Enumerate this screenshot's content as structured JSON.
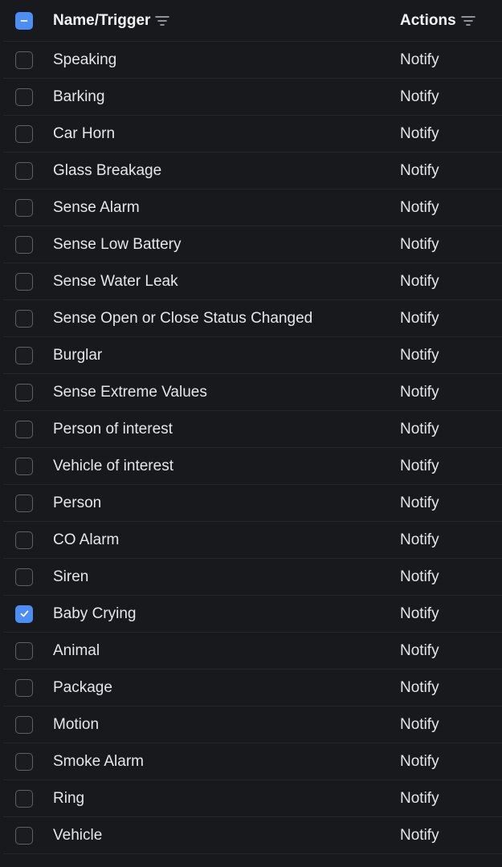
{
  "header": {
    "name_label": "Name/Trigger",
    "actions_label": "Actions",
    "filter_icon": "filter-lines-icon",
    "select_all_state": "indeterminate"
  },
  "colors": {
    "background": "#18191c",
    "accent": "#4d8df6",
    "divider": "#26272b",
    "text": "#e6e7ea"
  },
  "rows": [
    {
      "name": "Speaking",
      "action": "Notify",
      "checked": false
    },
    {
      "name": "Barking",
      "action": "Notify",
      "checked": false
    },
    {
      "name": "Car Horn",
      "action": "Notify",
      "checked": false
    },
    {
      "name": "Glass Breakage",
      "action": "Notify",
      "checked": false
    },
    {
      "name": "Sense Alarm",
      "action": "Notify",
      "checked": false
    },
    {
      "name": "Sense Low Battery",
      "action": "Notify",
      "checked": false
    },
    {
      "name": "Sense Water Leak",
      "action": "Notify",
      "checked": false
    },
    {
      "name": "Sense Open or Close Status Changed",
      "action": "Notify",
      "checked": false
    },
    {
      "name": "Burglar",
      "action": "Notify",
      "checked": false
    },
    {
      "name": "Sense Extreme Values",
      "action": "Notify",
      "checked": false
    },
    {
      "name": "Person of interest",
      "action": "Notify",
      "checked": false
    },
    {
      "name": "Vehicle of interest",
      "action": "Notify",
      "checked": false
    },
    {
      "name": "Person",
      "action": "Notify",
      "checked": false
    },
    {
      "name": "CO Alarm",
      "action": "Notify",
      "checked": false
    },
    {
      "name": "Siren",
      "action": "Notify",
      "checked": false
    },
    {
      "name": "Baby Crying",
      "action": "Notify",
      "checked": true
    },
    {
      "name": "Animal",
      "action": "Notify",
      "checked": false
    },
    {
      "name": "Package",
      "action": "Notify",
      "checked": false
    },
    {
      "name": "Motion",
      "action": "Notify",
      "checked": false
    },
    {
      "name": "Smoke Alarm",
      "action": "Notify",
      "checked": false
    },
    {
      "name": "Ring",
      "action": "Notify",
      "checked": false
    },
    {
      "name": "Vehicle",
      "action": "Notify",
      "checked": false
    }
  ]
}
